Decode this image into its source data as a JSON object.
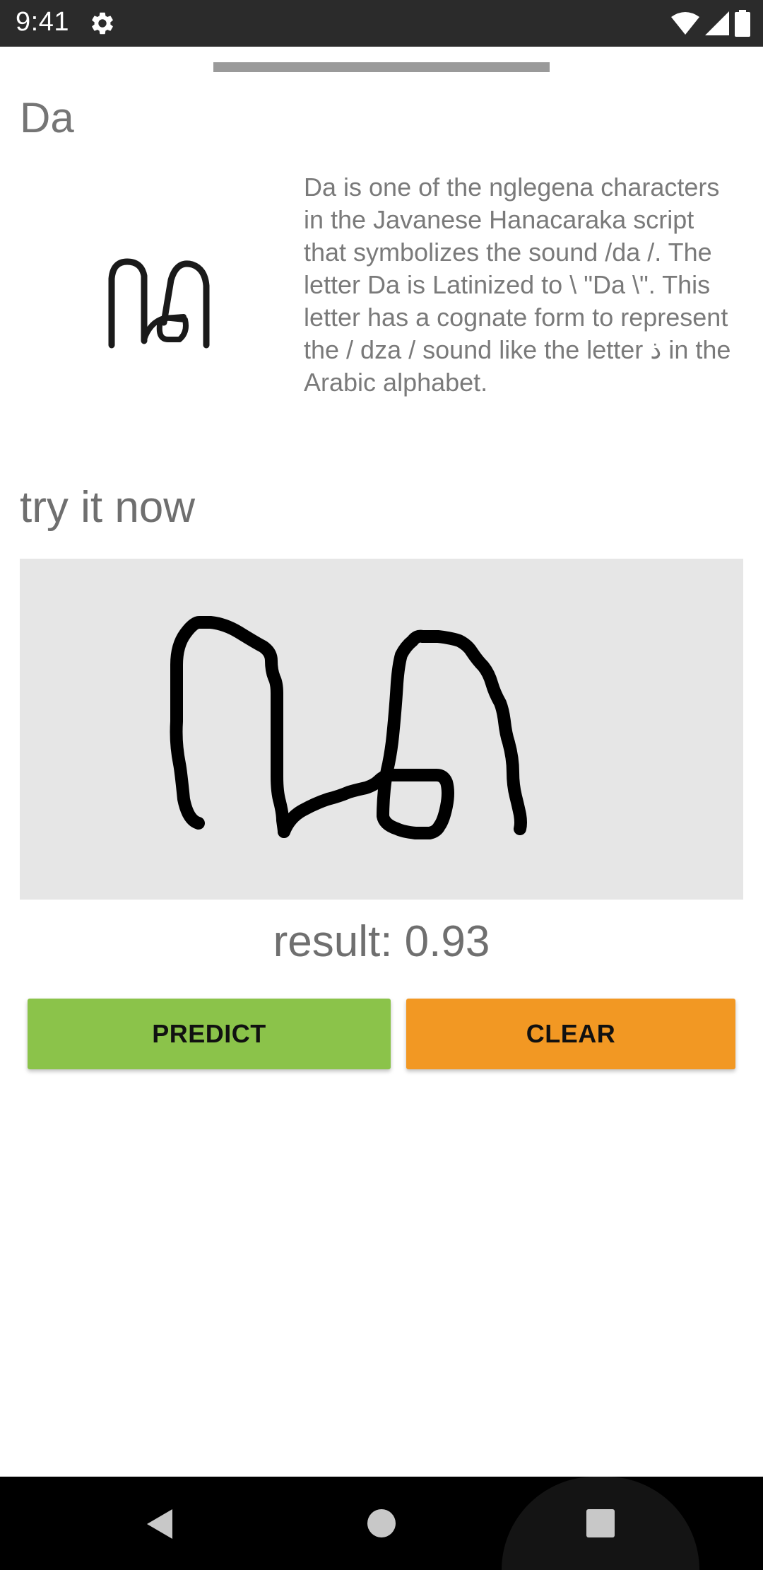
{
  "status_bar": {
    "time": "9:41",
    "icons": [
      "gear-icon",
      "wifi-icon",
      "cellular-signal-icon",
      "battery-icon"
    ]
  },
  "character": {
    "title": "Da",
    "glyph_icon": "javanese-da-glyph",
    "description": "Da is one of the nglegena characters in the Javanese Hanacaraka script that symbolizes the sound /da /. The letter Da is Latinized to \\ \"Da \\\". This letter has a cognate form to represent the / dza / sound like the letter ذ in the Arabic alphabet."
  },
  "practice": {
    "heading": "try it now",
    "result_text": "result: 0.93"
  },
  "buttons": {
    "predict_label": "PREDICT",
    "clear_label": "CLEAR"
  },
  "colors": {
    "status_bar_bg": "#2b2b2b",
    "predict_bg": "#8bc34a",
    "clear_bg": "#f29823",
    "canvas_bg": "#e6e6e6",
    "text_gray": "#757575",
    "nav_bar_bg": "#000000"
  },
  "nav_bar": {
    "icons": [
      "back-icon",
      "home-icon",
      "recents-icon"
    ]
  }
}
